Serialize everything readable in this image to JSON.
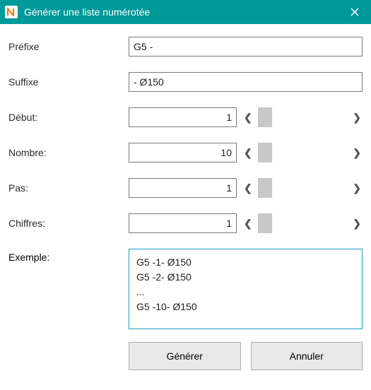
{
  "window": {
    "title": "Générer une liste numérotée"
  },
  "labels": {
    "prefix": "Préfixe",
    "suffix": "Suffixe",
    "begin": "Début:",
    "count": "Nombre:",
    "step": "Pas:",
    "digits": "Chiffres:",
    "example": "Exemple:"
  },
  "values": {
    "prefix": "G5 -",
    "suffix": "- Ø150",
    "begin": "1",
    "count": "10",
    "step": "1",
    "digits": "1"
  },
  "example_lines": [
    "G5 -1- Ø150",
    "G5 -2- Ø150",
    "...",
    "G5 -10- Ø150"
  ],
  "buttons": {
    "generate": "Générer",
    "cancel": "Annuler"
  },
  "icons": {
    "left": "❮",
    "right": "❯"
  }
}
